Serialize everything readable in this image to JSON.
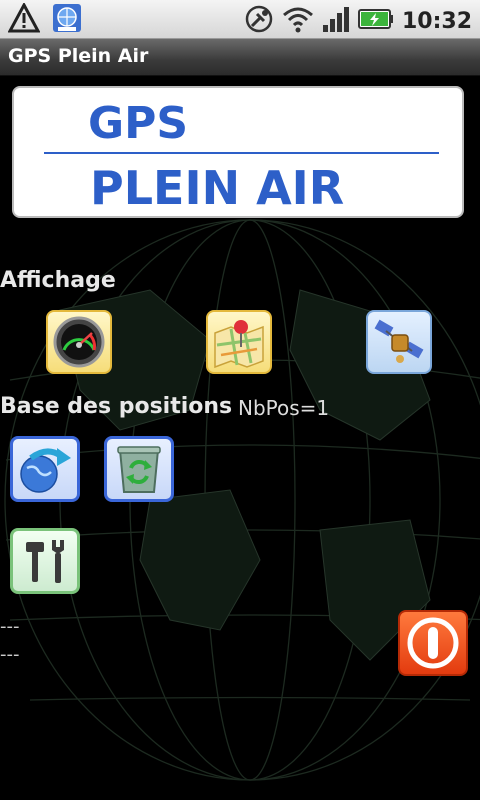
{
  "status_bar": {
    "time": "10:32",
    "icons": [
      "alert-icon",
      "globe-notification-icon",
      "gps-satellite-icon",
      "wifi-icon",
      "signal-icon",
      "battery-charging-icon"
    ]
  },
  "app": {
    "title": "GPS Plein Air"
  },
  "banner": {
    "line1": "GPS",
    "line2": "PLEIN AIR"
  },
  "affichage": {
    "title": "Affichage",
    "buttons": [
      "speedometer-icon",
      "map-pin-icon",
      "satellite-icon"
    ]
  },
  "base_positions": {
    "title": "Base des positions",
    "nbpos": "NbPos=1",
    "buttons": [
      "export-globe-icon",
      "recycle-bin-icon"
    ]
  },
  "tools": {
    "buttons": [
      "tools-icon"
    ]
  },
  "readouts": {
    "line1": "---",
    "line2": "---"
  },
  "colors": {
    "banner_blue": "#2d5fc8",
    "exit_orange": "#f05a1e"
  }
}
